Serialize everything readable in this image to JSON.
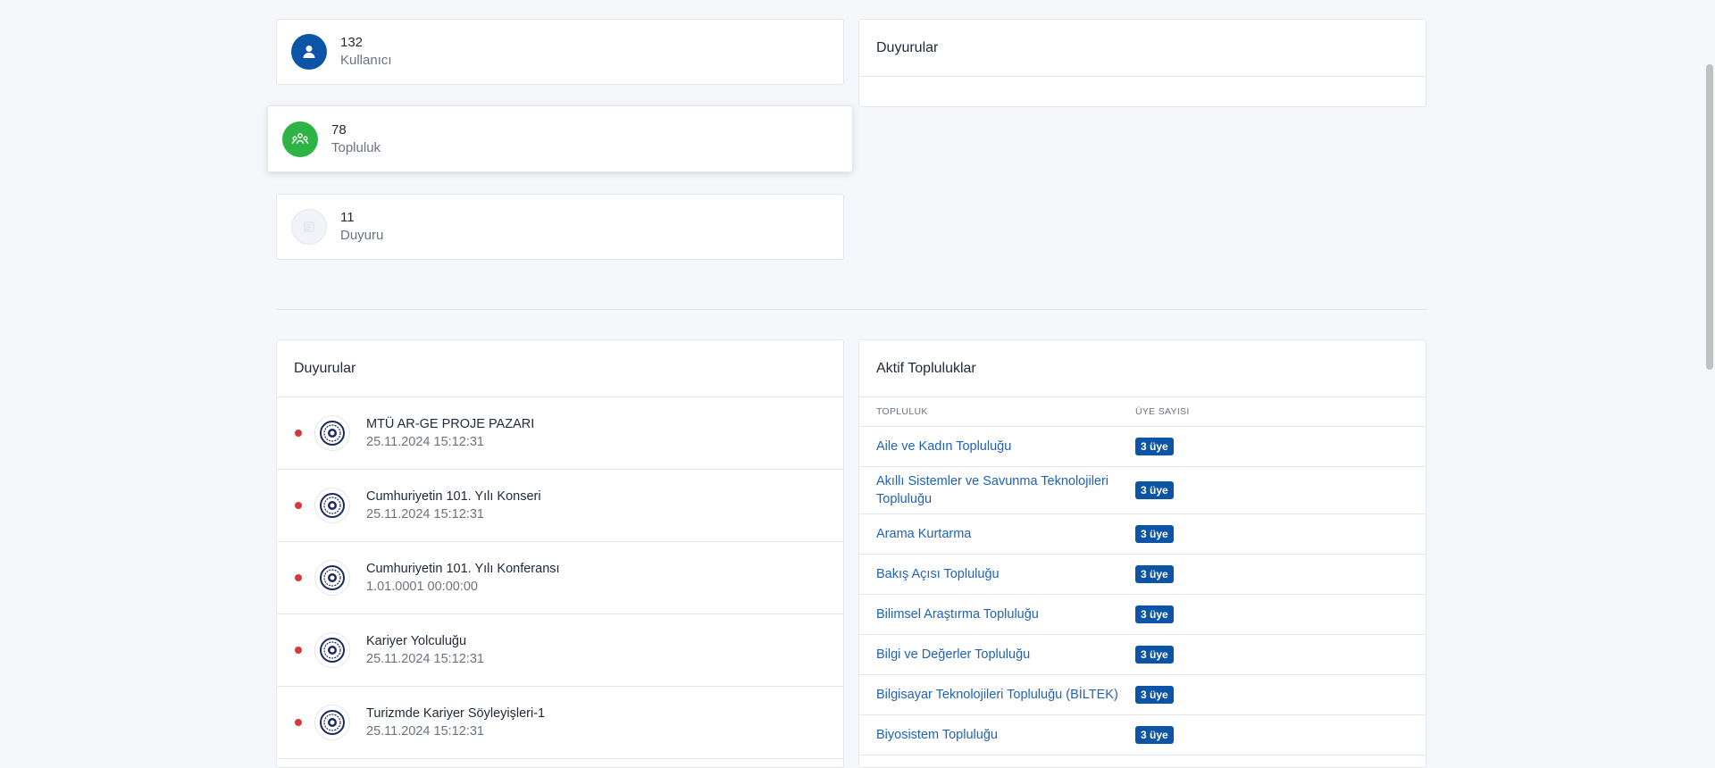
{
  "stats": [
    {
      "value": "132",
      "label": "Kullanıcı",
      "color": "#0b54a6",
      "icon": "user-icon"
    },
    {
      "value": "78",
      "label": "Topluluk",
      "color": "#2fb344",
      "icon": "community-icon"
    },
    {
      "value": "11",
      "label": "Duyuru",
      "color": "#f1f3f8",
      "icon": "announcement-icon"
    }
  ],
  "top_announcements": {
    "title": "Duyurular"
  },
  "announcements": {
    "title": "Duyurular",
    "items": [
      {
        "title": "MTÜ AR-GE PROJE PAZARI",
        "date": "25.11.2024 15:12:31"
      },
      {
        "title": "Cumhuriyetin 101. Yılı Konseri",
        "date": "25.11.2024 15:12:31"
      },
      {
        "title": "Cumhuriyetin 101. Yılı Konferansı",
        "date": "1.01.0001 00:00:00"
      },
      {
        "title": "Kariyer Yolculuğu",
        "date": "25.11.2024 15:12:31"
      },
      {
        "title": "Turizmde Kariyer Söyleyişleri-1",
        "date": "25.11.2024 15:12:31"
      }
    ]
  },
  "active": {
    "title": "Aktif Topluluklar",
    "col_name": "TOPLULUK",
    "col_members": "ÜYE SAYISI",
    "rows": [
      {
        "name": "Aile ve Kadın Topluluğu",
        "members": "3 üye"
      },
      {
        "name": "Akıllı Sistemler ve Savunma Teknolojileri Topluluğu",
        "members": "3 üye"
      },
      {
        "name": "Arama Kurtarma",
        "members": "3 üye"
      },
      {
        "name": "Bakış Açısı Topluluğu",
        "members": "3 üye"
      },
      {
        "name": "Bilimsel Araştırma Topluluğu",
        "members": "3 üye"
      },
      {
        "name": "Bilgi ve Değerler Topluluğu",
        "members": "3 üye"
      },
      {
        "name": "Bilgisayar Teknolojileri Topluluğu (BİLTEK)",
        "members": "3 üye"
      },
      {
        "name": "Biyosistem Topluluğu",
        "members": "3 üye"
      }
    ]
  }
}
